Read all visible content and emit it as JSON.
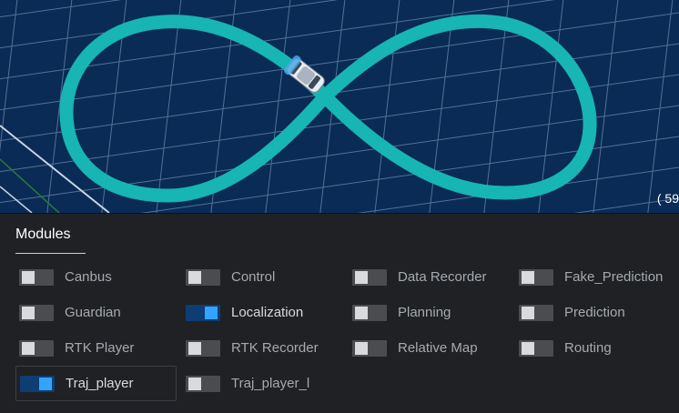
{
  "scene": {
    "coordinate_text": "( 59",
    "colors": {
      "background": "#0a2b56",
      "grid": "#5f7e9f",
      "trajectory": "#17b5b3",
      "boundary_line": "#c8d4e2"
    },
    "vehicle_icon": "car-icon"
  },
  "panel": {
    "tab_label": "Modules",
    "modules": [
      {
        "label": "Canbus",
        "enabled": false
      },
      {
        "label": "Control",
        "enabled": false
      },
      {
        "label": "Data Recorder",
        "enabled": false
      },
      {
        "label": "Fake_Prediction",
        "enabled": false
      },
      {
        "label": "Guardian",
        "enabled": false
      },
      {
        "label": "Localization",
        "enabled": true
      },
      {
        "label": "Planning",
        "enabled": false
      },
      {
        "label": "Prediction",
        "enabled": false
      },
      {
        "label": "RTK Player",
        "enabled": false
      },
      {
        "label": "RTK Recorder",
        "enabled": false
      },
      {
        "label": "Relative Map",
        "enabled": false
      },
      {
        "label": "Routing",
        "enabled": false
      },
      {
        "label": "Traj_player",
        "enabled": true,
        "selected": true
      },
      {
        "label": "Traj_player_l",
        "enabled": false
      }
    ]
  }
}
